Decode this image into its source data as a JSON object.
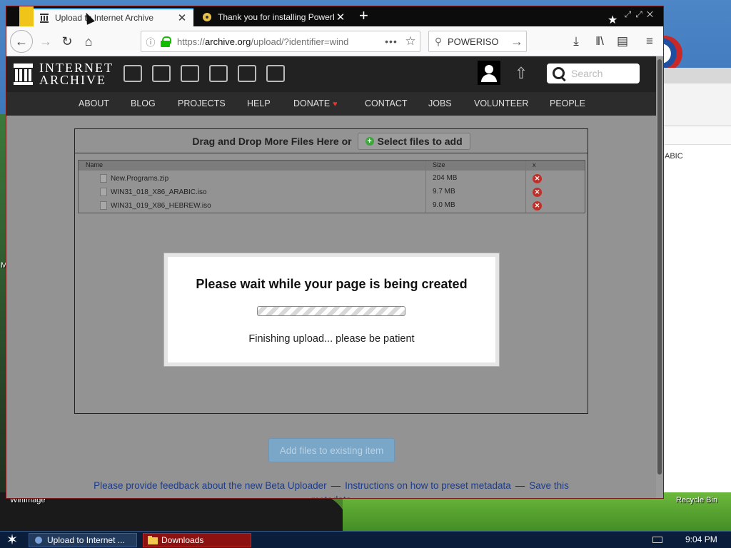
{
  "browser": {
    "tabs": [
      {
        "label": "Upload to Internet Archive",
        "active": true
      },
      {
        "label": "Thank you for installing PowerISO!",
        "active": false
      }
    ],
    "new_tab_label": "+",
    "url": {
      "prefix": "https://",
      "host": "archive.org",
      "path": "/upload/?identifier=wind"
    },
    "url_more": "•••",
    "search_value": "POWERISO"
  },
  "ia": {
    "logo_line1": "INTERNET",
    "logo_line2": "ARCHIVE",
    "search_placeholder": "Search",
    "nav": [
      "ABOUT",
      "BLOG",
      "PROJECTS",
      "HELP",
      "DONATE",
      "CONTACT",
      "JOBS",
      "VOLUNTEER",
      "PEOPLE"
    ],
    "donate_heart": "♥"
  },
  "upload": {
    "drop_text": "Drag and Drop More Files Here or",
    "select_label": "Select files to add",
    "columns": {
      "name": "Name",
      "size": "Size",
      "x": "x"
    },
    "files": [
      {
        "name": "New.Programs.zip",
        "size": "204 MB"
      },
      {
        "name": "WIN31_018_X86_ARABIC.iso",
        "size": "9.7 MB"
      },
      {
        "name": "WIN31_019_X86_HEBREW.iso",
        "size": "9.0 MB"
      }
    ],
    "add_button": "Add files to existing item",
    "footer": {
      "link1": "Please provide feedback about the new Beta Uploader",
      "link2": "Instructions on how to preset metadata",
      "link3": "Save this metadata"
    }
  },
  "modal": {
    "title": "Please wait while your page is being created",
    "message": "Finishing upload... please be patient"
  },
  "desktop": {
    "left_label": "WinImage",
    "right_label": "Recycle Bin",
    "bg_window_text": "ABIC",
    "edge_label": "M"
  },
  "taskbar": {
    "items": [
      "Upload to Internet ...",
      "Downloads"
    ],
    "clock": "9:04 PM"
  },
  "colors": {
    "tab_accent": "#0a84ff",
    "lock_green": "#12bc00",
    "delete_red": "#c0302b",
    "link_blue": "#1e3c8c",
    "ia_header": "#222222"
  }
}
